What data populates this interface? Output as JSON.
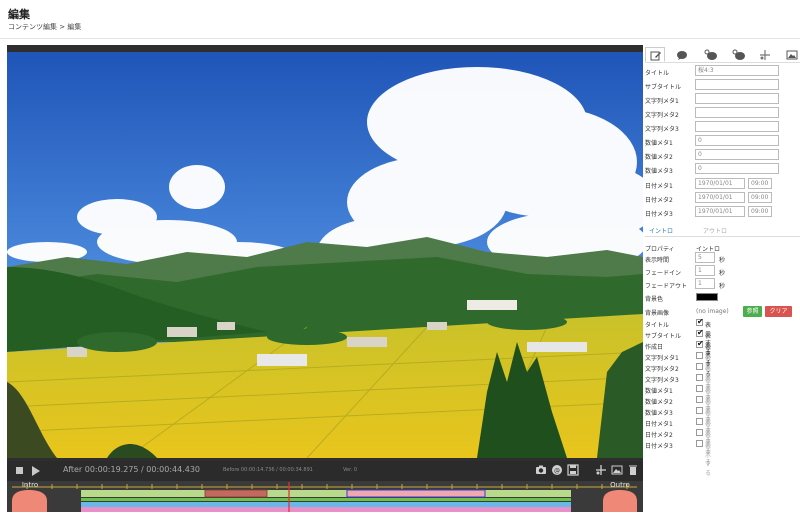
{
  "header": {
    "title": "編集",
    "breadcrumb": "コンテンツ編集 > 編集"
  },
  "player": {
    "time": "After 00:00:19.275 / 00:00:44.430",
    "before": "Before 00:00:14.736 / 00:00:34.891",
    "version": "Ver. 0",
    "intro_label": "Intro",
    "outro_label": "Outro"
  },
  "panel": {
    "tabs": [
      "edit-icon",
      "caption-icon",
      "caption-plus-icon",
      "caption-minus-icon",
      "cut-icon",
      "image-icon"
    ],
    "fields": [
      {
        "label": "タイトル",
        "value": "桜4:3"
      },
      {
        "label": "サブタイトル",
        "value": ""
      },
      {
        "label": "文字列メタ1",
        "value": ""
      },
      {
        "label": "文字列メタ2",
        "value": ""
      },
      {
        "label": "文字列メタ3",
        "value": ""
      },
      {
        "label": "数値メタ1",
        "value": "0"
      },
      {
        "label": "数値メタ2",
        "value": "0"
      },
      {
        "label": "数値メタ3",
        "value": "0"
      }
    ],
    "dates": [
      {
        "label": "日付メタ1",
        "date": "1970/01/01",
        "time": "09:00"
      },
      {
        "label": "日付メタ2",
        "date": "1970/01/01",
        "time": "09:00"
      },
      {
        "label": "日付メタ3",
        "date": "1970/01/01",
        "time": "09:00"
      }
    ],
    "subtabs": {
      "intro": "イントロ",
      "outro": "アウトロ"
    },
    "property": {
      "label": "プロパティ",
      "value": "イントロ"
    },
    "display_time": {
      "label": "表示時間",
      "value": "5",
      "unit": "秒"
    },
    "fade_in": {
      "label": "フェードイン",
      "value": "1",
      "unit": "秒"
    },
    "fade_out": {
      "label": "フェードアウト",
      "value": "1",
      "unit": "秒"
    },
    "bg_color": {
      "label": "背景色",
      "color": "#000000"
    },
    "bg_image": {
      "label": "背景画像",
      "value": "(no image)",
      "ref": "参照",
      "clear": "クリア"
    },
    "show_label": "表示する",
    "checks": [
      {
        "label": "タイトル",
        "on": true
      },
      {
        "label": "サブタイトル",
        "on": true
      },
      {
        "label": "作成日",
        "on": true
      },
      {
        "label": "文字列メタ1",
        "on": false
      },
      {
        "label": "文字列メタ2",
        "on": false
      },
      {
        "label": "文字列メタ3",
        "on": false
      },
      {
        "label": "数値メタ1",
        "on": false
      },
      {
        "label": "数値メタ2",
        "on": false
      },
      {
        "label": "数値メタ3",
        "on": false
      },
      {
        "label": "日付メタ1",
        "on": false
      },
      {
        "label": "日付メタ2",
        "on": false
      },
      {
        "label": "日付メタ3",
        "on": false
      }
    ]
  },
  "colors": {
    "accent_green": "#4cae4c",
    "accent_red": "#d9534f",
    "link_blue": "#2a7ab8"
  }
}
